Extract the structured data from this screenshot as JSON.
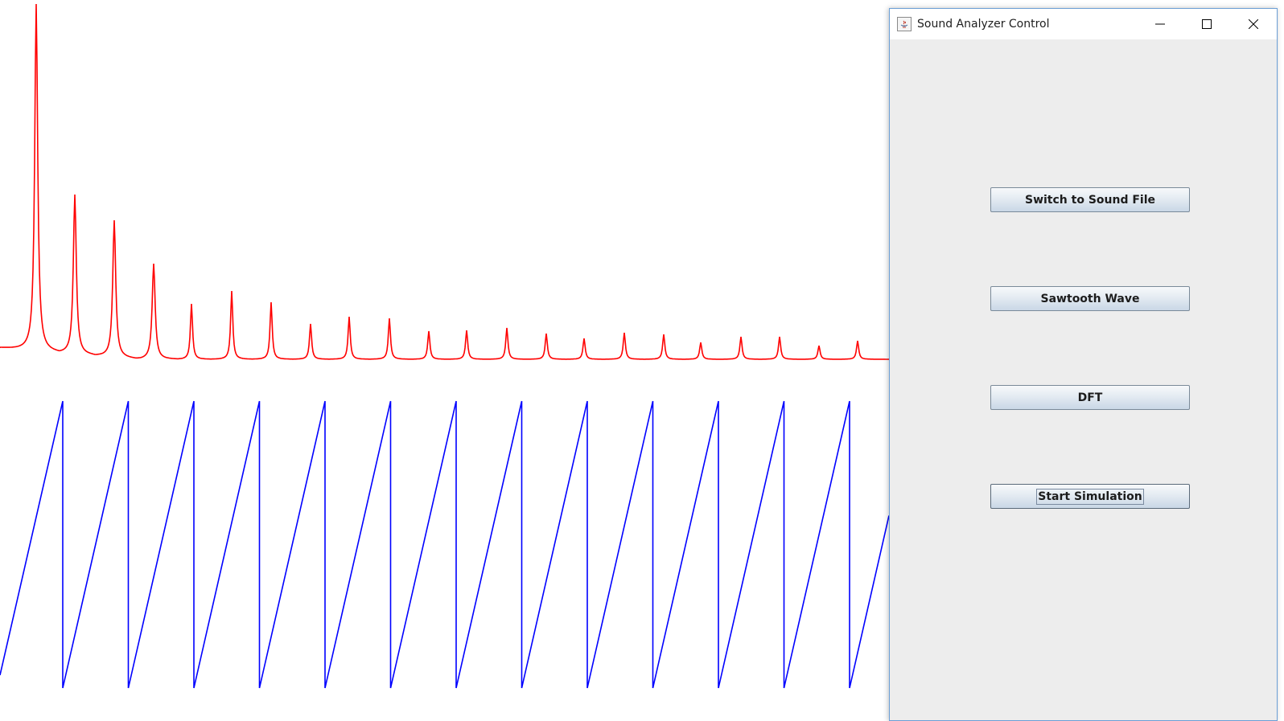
{
  "window": {
    "title": "Sound Analyzer Control",
    "controls": {
      "minimize": "minimize-icon",
      "maximize": "maximize-icon",
      "close": "close-icon"
    }
  },
  "buttons": [
    {
      "label": "Switch to Sound File"
    },
    {
      "label": "Sawtooth Wave"
    },
    {
      "label": "DFT"
    },
    {
      "label": "Start Simulation",
      "focused": true
    }
  ],
  "visualization": {
    "spectrum_color": "#ff0000",
    "waveform_color": "#0000ff",
    "waveform": "sawtooth",
    "spectrum_peak_count": 22
  }
}
